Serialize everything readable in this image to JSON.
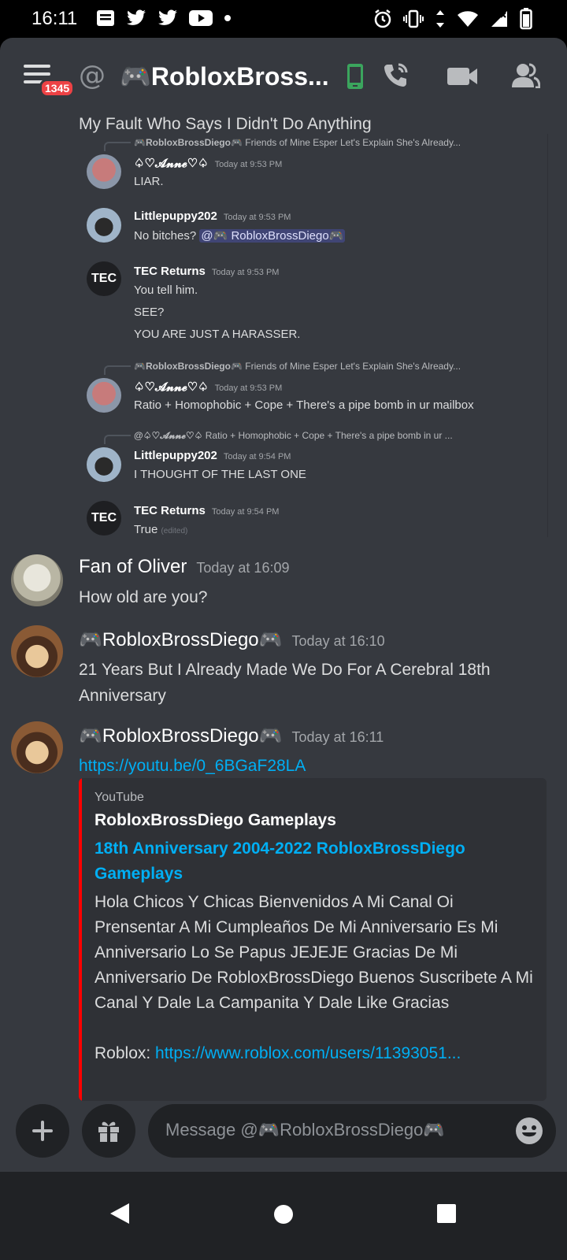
{
  "status": {
    "time": "16:11",
    "icons_left": [
      "notification-icon",
      "twitter-icon",
      "twitter-icon",
      "youtube-icon",
      "dot-icon"
    ],
    "icons_right": [
      "alarm-icon",
      "vibrate-icon",
      "data-icon",
      "wifi-icon",
      "signal-icon",
      "battery-icon"
    ]
  },
  "header": {
    "badge": "1345",
    "title": "🎮RobloxBross...",
    "icons": [
      "mobile-status-icon",
      "call-icon",
      "video-call-icon",
      "members-icon"
    ]
  },
  "screenshot_embed": {
    "top_line": "My Fault Who Says I Didn't Do Anything",
    "messages": [
      {
        "reply": "🎮RobloxBrossDiego🎮",
        "reply_text": "Friends of Mine Esper Let's Explain She's Already...",
        "name": "♤♡𝓐𝓷𝓷𝓮♡♤",
        "time": "Today at 9:53 PM",
        "lines": [
          "LIAR."
        ]
      },
      {
        "name": "Littlepuppy202",
        "time": "Today at 9:53 PM",
        "text": "No bitches?",
        "mention": "@🎮 RobloxBrossDiego🎮"
      },
      {
        "name": "TEC Returns",
        "time": "Today at 9:53 PM",
        "lines": [
          "You tell him.",
          "SEE?",
          "YOU ARE JUST A HARASSER."
        ]
      },
      {
        "reply": "🎮RobloxBrossDiego🎮",
        "reply_text": "Friends of Mine Esper Let's Explain She's Already...",
        "name": "♤♡𝓐𝓷𝓷𝓮♡♤",
        "time": "Today at 9:53 PM",
        "lines": [
          "Ratio + Homophobic + Cope + There's a pipe bomb in ur mailbox"
        ]
      },
      {
        "reply": "@♤♡𝓐𝓷𝓷𝓮♡♤",
        "reply_text": "Ratio + Homophobic + Cope + There's a pipe bomb in ur ...",
        "name": "Littlepuppy202",
        "time": "Today at 9:54 PM",
        "lines": [
          "I THOUGHT OF THE LAST ONE"
        ]
      },
      {
        "name": "TEC Returns",
        "time": "Today at 9:54 PM",
        "lines": [
          "True"
        ],
        "edited": "(edited)"
      }
    ]
  },
  "messages": [
    {
      "name": "Fan of Oliver",
      "time": "Today at 16:09",
      "text": "How old are you?"
    },
    {
      "name": "🎮RobloxBrossDiego🎮",
      "time": "Today at 16:10",
      "text": "21 Years But I Already Made We Do For A Cerebral 18th Anniversary"
    },
    {
      "name": "🎮RobloxBrossDiego🎮",
      "time": "Today at 16:11",
      "link": "https://youtu.be/0_6BGaF28LA"
    }
  ],
  "youtube_embed": {
    "provider": "YouTube",
    "author": "RobloxBrossDiego Gameplays",
    "title": "18th Anniversary 2004-2022   RobloxBrossDiego Gameplays",
    "description": "Hola Chicos Y Chicas Bienvenidos A Mi Canal Oi Prensentar A Mi Cumpleaños De Mi Anniversario Es Mi Anniversario Lo Se Papus JEJEJE Gracias De Mi Anniversario De RobloxBrossDiego Buenos Suscribete A Mi Canal Y Dale La Campanita Y Dale Like Gracias",
    "roblox_label": "Roblox: ",
    "roblox_link": "https://www.roblox.com/users/11393051...",
    "accent": "#ff0000"
  },
  "composer": {
    "placeholder": "Message @🎮RobloxBrossDiego🎮",
    "buttons": [
      "add-icon",
      "gift-icon",
      "emoji-icon"
    ]
  },
  "navbar": {
    "buttons": [
      "back-icon",
      "home-icon",
      "recents-icon"
    ]
  },
  "colors": {
    "bg": "#36393f",
    "embed_bg": "#2f3136",
    "link": "#00aff4",
    "badge": "#ed4245",
    "mobile_status": "#3ba55d"
  }
}
